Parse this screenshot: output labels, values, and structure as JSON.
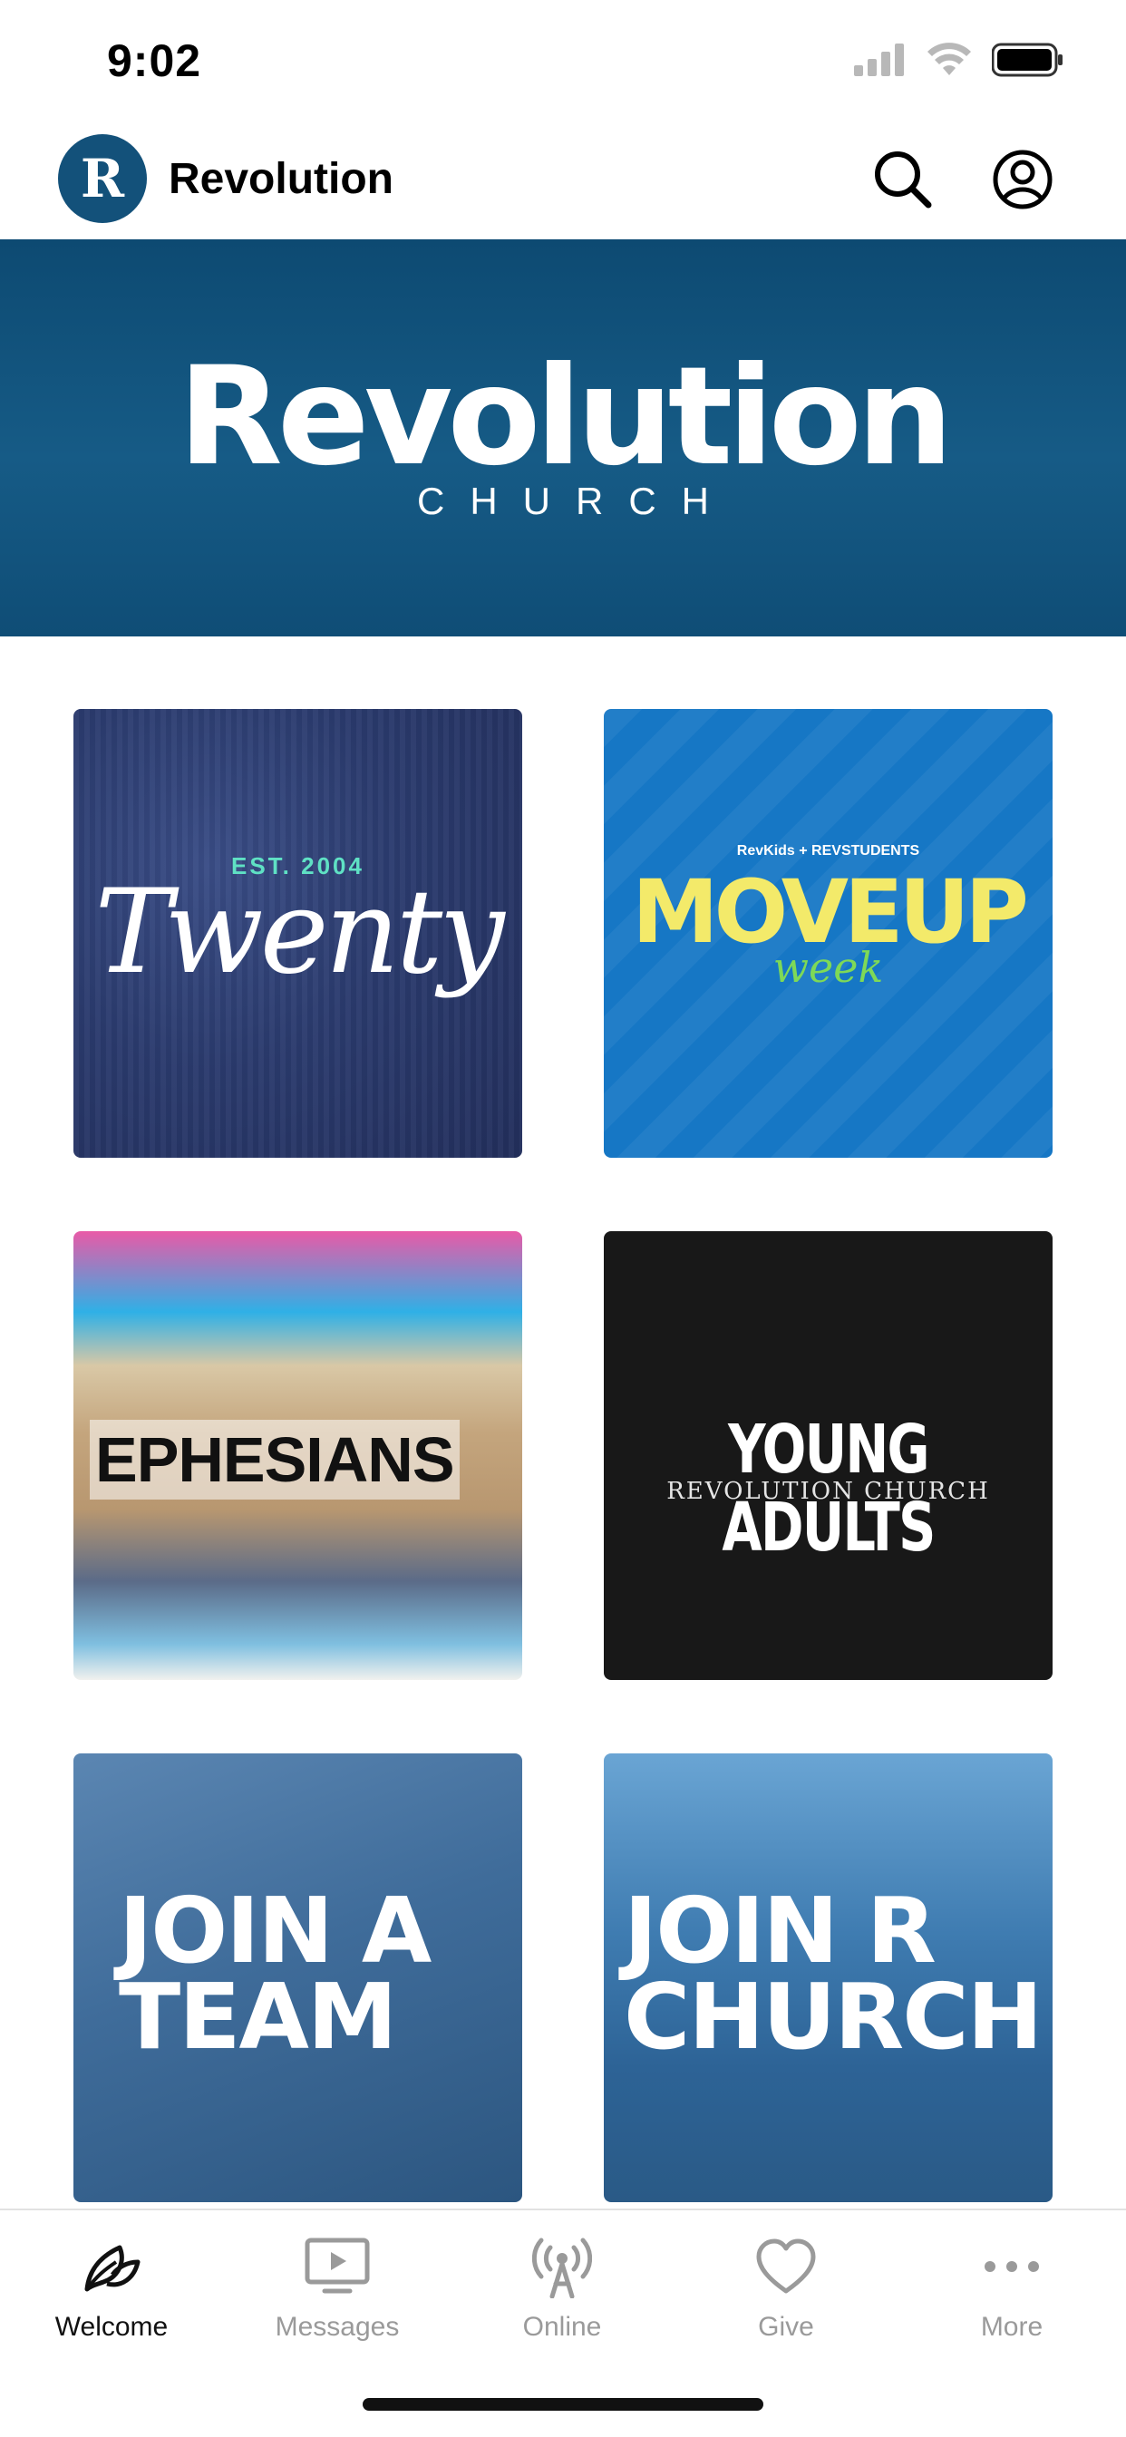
{
  "status_bar": {
    "time": "9:02"
  },
  "header": {
    "app_title": "Revolution",
    "logo_letter": "R"
  },
  "hero": {
    "title": "Revolution",
    "subtitle": "CHURCH"
  },
  "tiles": [
    {
      "id": "twenty",
      "est": "EST. 2004",
      "title": "Twenty"
    },
    {
      "id": "moveup",
      "top": "RevKids + REVSTUDENTS",
      "title": "MOVEUP",
      "week": "week"
    },
    {
      "id": "ephesians",
      "title": "EPHESIANS"
    },
    {
      "id": "young-adults",
      "title": "YOUNG ADULTS",
      "subtitle": "REVOLUTION CHURCH"
    },
    {
      "id": "join-team",
      "line1": "JOIN A",
      "line2": "TEAM"
    },
    {
      "id": "join-church",
      "line1": "JOIN R",
      "line2": "CHURCH"
    }
  ],
  "tab_bar": {
    "tabs": [
      {
        "label": "Welcome",
        "icon": "leaf-icon",
        "active": true
      },
      {
        "label": "Messages",
        "icon": "tv-play-icon",
        "active": false
      },
      {
        "label": "Online",
        "icon": "antenna-icon",
        "active": false
      },
      {
        "label": "Give",
        "icon": "heart-icon",
        "active": false
      },
      {
        "label": "More",
        "icon": "more-dots-icon",
        "active": false
      }
    ]
  },
  "colors": {
    "brand": "#13517a",
    "hero_bg": "#0f4d76",
    "tab_active": "#111111",
    "tab_inactive": "#9a9a9a"
  }
}
